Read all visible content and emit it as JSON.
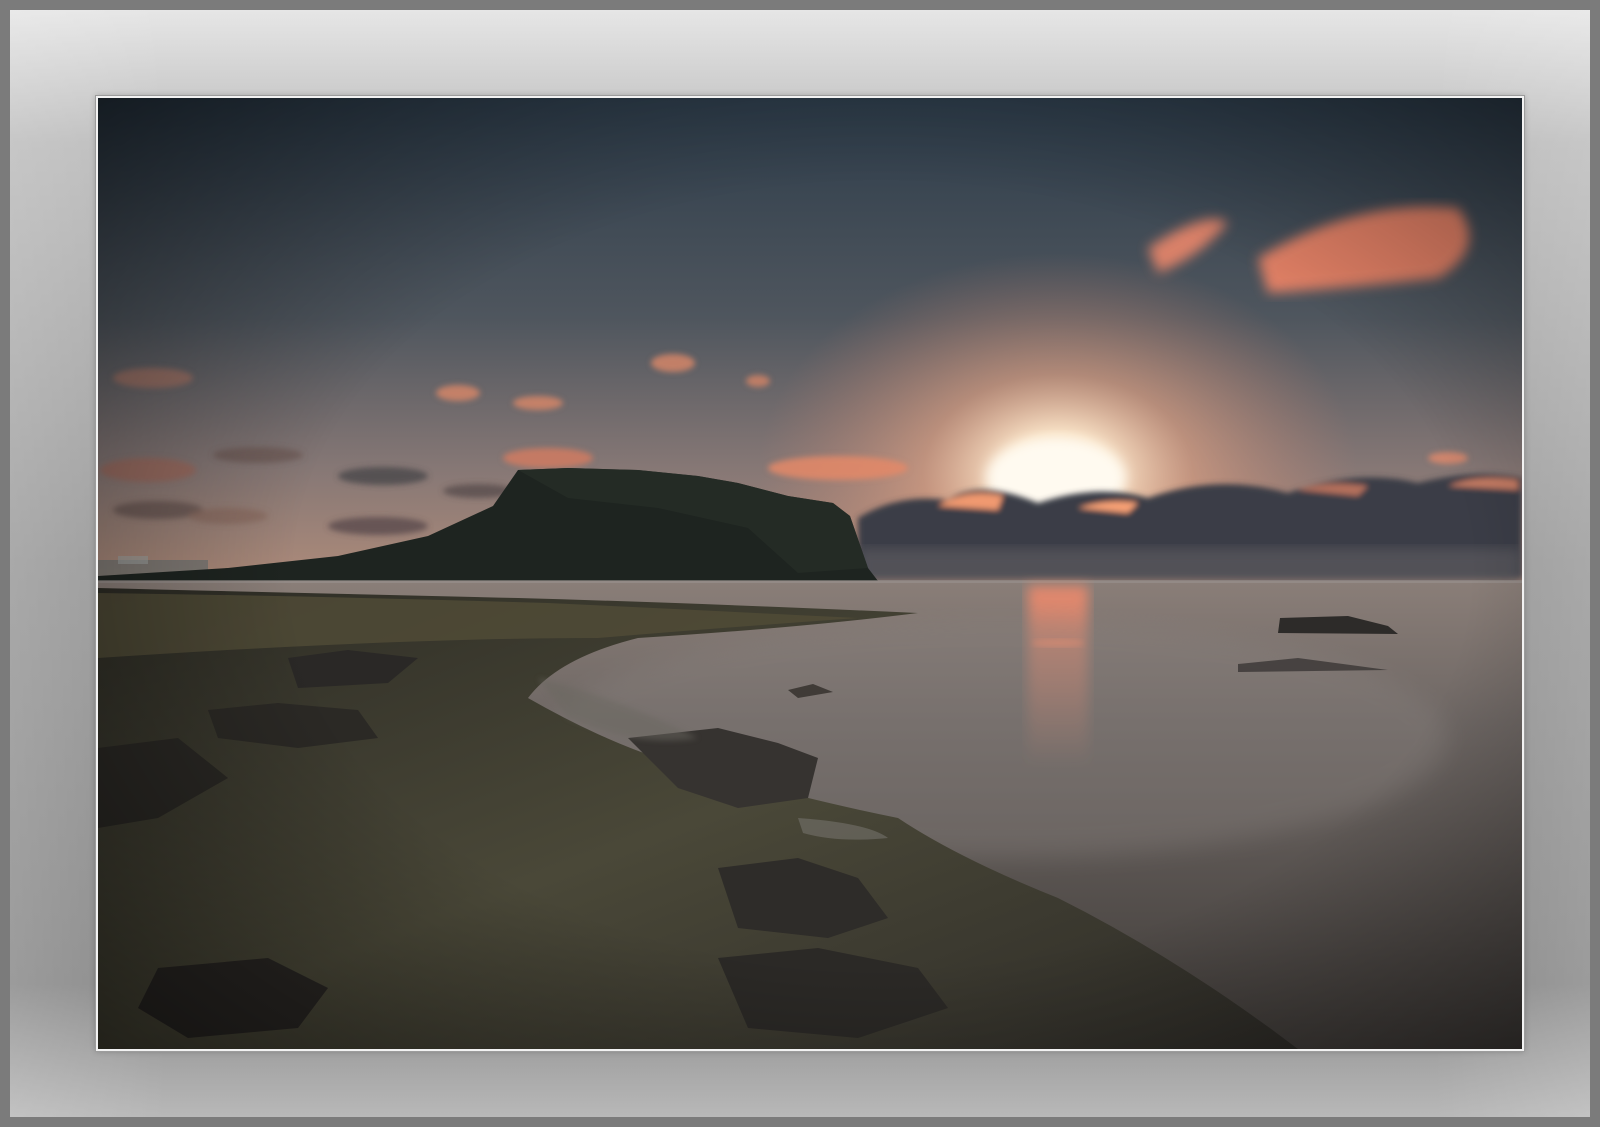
{
  "photo": {
    "sky_top": "#2f3e4c",
    "sky_mid": "#5b6168",
    "sky_horizon": "#a98a7a",
    "sun_color": "#fff3dc",
    "cloud_glow": "#f0896a",
    "mountain_color": "#1f2520",
    "sea_color": "#6f6a66",
    "rock_color": "#3b3a32"
  }
}
